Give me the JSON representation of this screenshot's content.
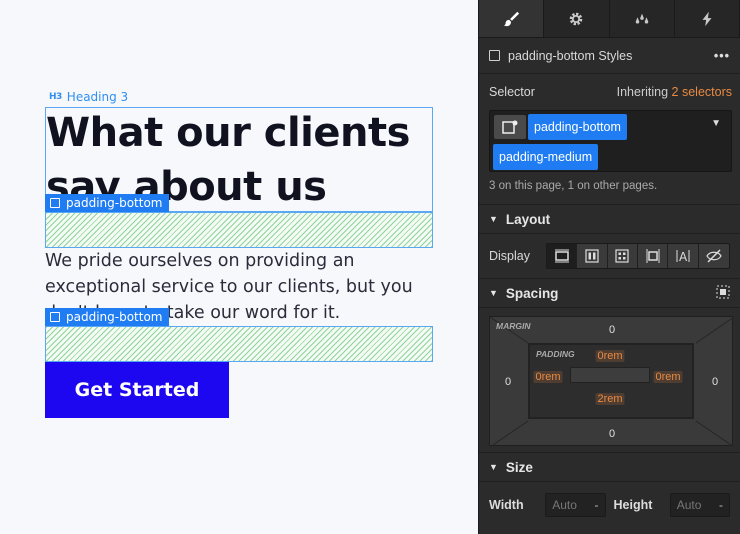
{
  "canvas": {
    "element_tag": "Heading 3",
    "element_tag_icon": "H3",
    "heading": "What our clients say about us",
    "paragraph": "We pride ourselves on providing an exceptional service to our clients, but you don't have to take our word for it.",
    "selection_tag_1": "padding-bottom",
    "selection_tag_2": "padding-bottom",
    "cta_label": "Get Started"
  },
  "panel": {
    "tabs": [
      "style-tab",
      "settings-tab",
      "interactions-tab",
      "lightning-tab"
    ],
    "style_header": "padding-bottom Styles",
    "selector": {
      "label": "Selector",
      "inheriting_prefix": "Inheriting",
      "inheriting_count": "2 selectors",
      "classes": [
        "padding-bottom",
        "padding-medium"
      ],
      "note": "3 on this page, 1 on other pages."
    },
    "layout": {
      "title": "Layout",
      "display_label": "Display",
      "display_options": [
        "block",
        "flex",
        "grid",
        "inline-block",
        "inline",
        "none"
      ],
      "active": "block"
    },
    "spacing": {
      "title": "Spacing",
      "margin_label": "MARGIN",
      "margin": {
        "top": "0",
        "right": "0",
        "bottom": "0",
        "left": "0"
      },
      "padding_label": "PADDING",
      "padding": {
        "top": "0rem",
        "right": "0rem",
        "bottom": "2rem",
        "left": "0rem"
      }
    },
    "size": {
      "title": "Size",
      "width_label": "Width",
      "width_value": "Auto",
      "width_unit": "-",
      "height_label": "Height",
      "height_value": "Auto",
      "height_unit": "-"
    }
  },
  "colors": {
    "selection_blue": "#1f7cf2",
    "cta_background": "#1d06f0",
    "accent_orange": "#e98a43",
    "panel_bg": "#2b2b2b"
  }
}
